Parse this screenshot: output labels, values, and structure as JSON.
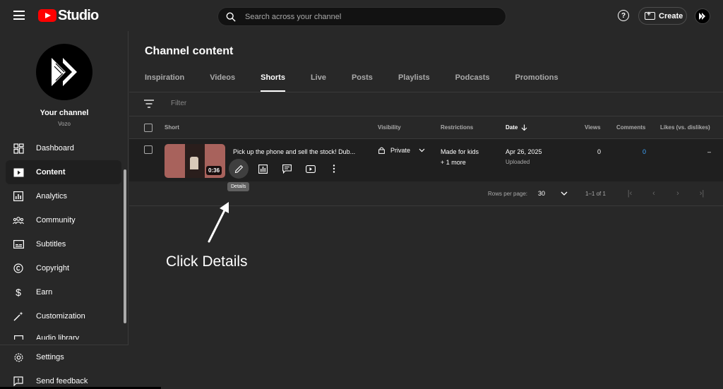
{
  "app": {
    "logo_text": "Studio"
  },
  "search": {
    "placeholder": "Search across your channel"
  },
  "header": {
    "help_label": "?",
    "create_label": "Create"
  },
  "channel": {
    "name": "Your channel",
    "handle": "Vozo"
  },
  "sidebar": {
    "items": [
      {
        "label": "Dashboard",
        "icon": "dashboard-icon",
        "active": false
      },
      {
        "label": "Content",
        "icon": "content-icon",
        "active": true
      },
      {
        "label": "Analytics",
        "icon": "analytics-icon",
        "active": false
      },
      {
        "label": "Community",
        "icon": "community-icon",
        "active": false
      },
      {
        "label": "Subtitles",
        "icon": "subtitles-icon",
        "active": false
      },
      {
        "label": "Copyright",
        "icon": "copyright-icon",
        "active": false
      },
      {
        "label": "Earn",
        "icon": "earn-icon",
        "active": false
      },
      {
        "label": "Customization",
        "icon": "customization-icon",
        "active": false
      },
      {
        "label": "Audio library",
        "icon": "audio-library-icon",
        "active": false
      }
    ],
    "bottom": [
      {
        "label": "Settings",
        "icon": "gear-icon"
      },
      {
        "label": "Send feedback",
        "icon": "feedback-icon"
      }
    ]
  },
  "main": {
    "title": "Channel content",
    "tabs": [
      "Inspiration",
      "Videos",
      "Shorts",
      "Live",
      "Posts",
      "Playlists",
      "Podcasts",
      "Promotions"
    ],
    "active_tab": "Shorts",
    "filter_placeholder": "Filter",
    "columns": {
      "short": "Short",
      "visibility": "Visibility",
      "restrictions": "Restrictions",
      "date": "Date",
      "views": "Views",
      "comments": "Comments",
      "likes": "Likes (vs. dislikes)"
    },
    "rows": [
      {
        "title": "Pick up the phone and sell the stock! Dub...",
        "duration": "0:36",
        "visibility": "Private",
        "restriction_line1": "Made for kids",
        "restriction_line2": "+ 1 more",
        "date": "Apr 26, 2025",
        "date_status": "Uploaded",
        "views": "0",
        "comments": "0",
        "likes": "–"
      }
    ],
    "tooltip": "Details",
    "pagination": {
      "rows_per_page_label": "Rows per page:",
      "rows_per_page": "30",
      "range": "1–1 of 1"
    }
  },
  "annotation": {
    "text": "Click Details"
  },
  "colors": {
    "accent_blue": "#3ea6ff",
    "brand_red": "#ff0000",
    "background": "#282828"
  }
}
